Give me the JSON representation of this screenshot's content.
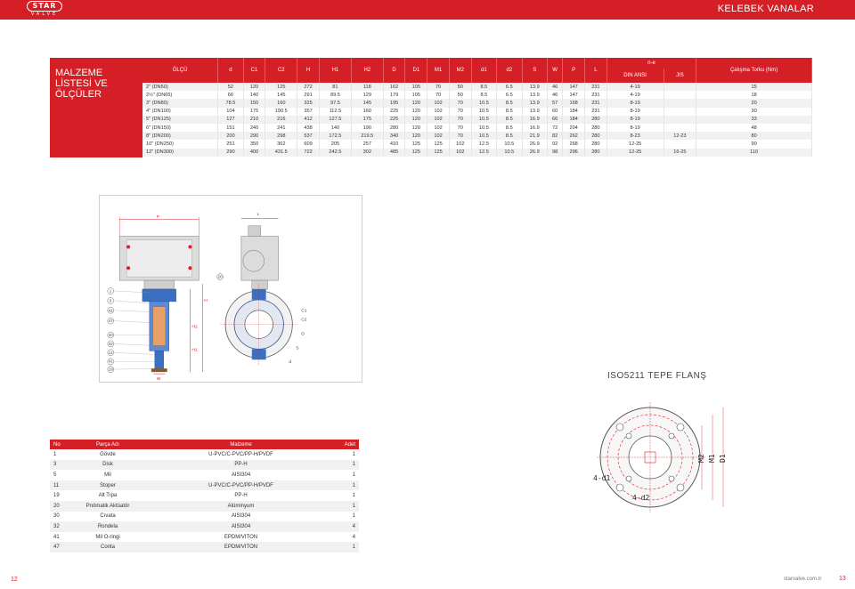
{
  "header": {
    "logo_text": "STAR",
    "logo_sub": "VALVE",
    "title": "KELEBEK VANALAR"
  },
  "side_box": {
    "line1": "MALZEME",
    "line2": "LİSTESİ VE",
    "line3": "ÖLÇÜLER"
  },
  "dims_table": {
    "headers": [
      "ÖLÇÜ",
      "d",
      "C1",
      "C2",
      "H",
      "H1",
      "H2",
      "D",
      "D1",
      "M1",
      "M2",
      "d1",
      "d2",
      "S",
      "W",
      "P",
      "L"
    ],
    "ne_header": "n-e",
    "din_header": "DIN ANSI",
    "jis_header": "JIS",
    "torque_header": "Çalışma Torku (Nm)",
    "rows": [
      [
        "2\" (DN50)",
        "52",
        "120",
        "125",
        "272",
        "81",
        "118",
        "162",
        "105",
        "70",
        "50",
        "8.5",
        "6.5",
        "13.9",
        "46",
        "147",
        "231",
        "4-19",
        "",
        "15"
      ],
      [
        "2½\" (DN65)",
        "66",
        "140",
        "145",
        "291",
        "89.5",
        "129",
        "179",
        "105",
        "70",
        "50",
        "8.5",
        "6.5",
        "13.9",
        "46",
        "147",
        "231",
        "4-19",
        "",
        "18"
      ],
      [
        "3\" (DN80)",
        "78.5",
        "150",
        "160",
        "325",
        "97.5",
        "145",
        "195",
        "120",
        "102",
        "70",
        "10.5",
        "8.5",
        "13.9",
        "57",
        "168",
        "231",
        "8-19",
        "",
        "20"
      ],
      [
        "4\" (DN100)",
        "104",
        "175",
        "190.5",
        "357",
        "112.5",
        "160",
        "225",
        "120",
        "102",
        "70",
        "10.5",
        "8.5",
        "13.9",
        "60",
        "184",
        "231",
        "8-19",
        "",
        "30"
      ],
      [
        "5\" (DN125)",
        "127",
        "210",
        "216",
        "412",
        "127.5",
        "175",
        "225",
        "120",
        "102",
        "70",
        "10.5",
        "8.5",
        "16.9",
        "66",
        "184",
        "280",
        "8-19",
        "",
        "33"
      ],
      [
        "6\" (DN150)",
        "151",
        "240",
        "241",
        "438",
        "140",
        "190",
        "280",
        "120",
        "102",
        "70",
        "10.5",
        "8.5",
        "16.9",
        "72",
        "204",
        "280",
        "8-19",
        "",
        "48"
      ],
      [
        "8\" (DN200)",
        "200",
        "290",
        "298",
        "537",
        "172.5",
        "219.5",
        "340",
        "120",
        "102",
        "70",
        "10.5",
        "8.5",
        "21.9",
        "82",
        "262",
        "280",
        "8-23",
        "12-23",
        "80"
      ],
      [
        "10\" (DN250)",
        "251",
        "350",
        "362",
        "609",
        "205",
        "257",
        "410",
        "125",
        "125",
        "102",
        "12.5",
        "10.5",
        "26.9",
        "92",
        "268",
        "280",
        "12-25",
        "",
        "90"
      ],
      [
        "12\" (DN300)",
        "290",
        "400",
        "431.5",
        "722",
        "242.5",
        "302",
        "485",
        "125",
        "125",
        "102",
        "12.5",
        "10.5",
        "26.9",
        "98",
        "296",
        "280",
        "12-25",
        "16-25",
        "110"
      ]
    ]
  },
  "drawing_labels": {
    "callouts": [
      "1",
      "3",
      "41",
      "47",
      "30",
      "32",
      "11",
      "41",
      "19",
      "20"
    ],
    "dims": [
      "P",
      "L",
      "W",
      "H",
      "H2",
      "H1",
      "S",
      "C1",
      "C2",
      "D",
      "d"
    ]
  },
  "iso": {
    "title": "ISO5211 TEPE FLANŞ",
    "labels": [
      "4-d1",
      "4-d2",
      "M2",
      "M1",
      "D1"
    ]
  },
  "parts_table": {
    "headers": [
      "No",
      "Parça Adı",
      "Malzeme",
      "Adet"
    ],
    "rows": [
      [
        "1",
        "Gövde",
        "U-PVC/C-PVC/PP-H/PVDF",
        "1"
      ],
      [
        "3",
        "Disk",
        "PP-H",
        "1"
      ],
      [
        "5",
        "Mil",
        "AISI304",
        "1"
      ],
      [
        "11",
        "Stoper",
        "U-PVC/C-PVC/PP-H/PVDF",
        "1"
      ],
      [
        "19",
        "Alt Tıpa",
        "PP-H",
        "1"
      ],
      [
        "20",
        "Pnömatik Aktüatör",
        "Alüminyum",
        "1"
      ],
      [
        "30",
        "Cıvata",
        "AISI304",
        "1"
      ],
      [
        "32",
        "Rondela",
        "AISI304",
        "4"
      ],
      [
        "41",
        "Mil O-ringi",
        "EPDM/VITON",
        "4"
      ],
      [
        "47",
        "Conta",
        "EPDM/VITON",
        "1"
      ]
    ]
  },
  "footer": {
    "page_left": "12",
    "site": "starvalve.com.tr",
    "page_right": "13"
  },
  "colors": {
    "brand_red": "#d51f26",
    "row_gray": "#f1f1f1"
  }
}
